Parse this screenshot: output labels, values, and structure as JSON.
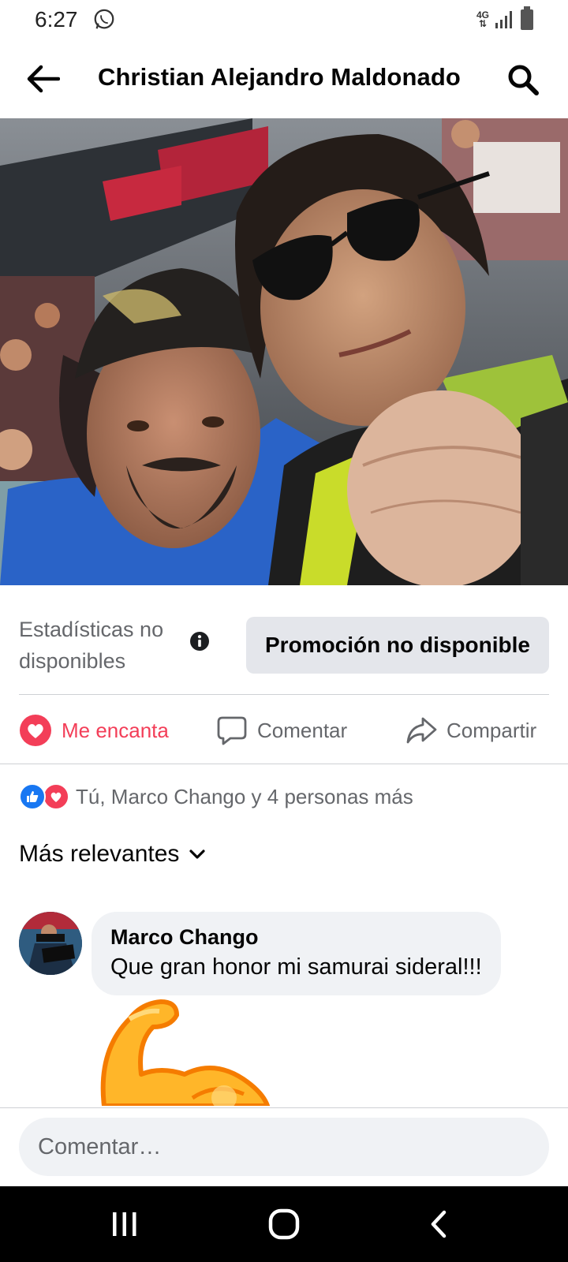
{
  "status_bar": {
    "time": "6:27",
    "network": "4G",
    "icons": [
      "whatsapp-icon",
      "signal-icon",
      "battery-icon"
    ]
  },
  "header": {
    "title": "Christian Alejandro Maldonado",
    "back_icon": "arrow-left-icon",
    "search_icon": "search-icon"
  },
  "post": {
    "photo_icon": "photo",
    "stats_text": "Estadísticas no disponibles",
    "promo_label": "Promoción no disponible"
  },
  "actions": {
    "love_label": "Me encanta",
    "comment_label": "Comentar",
    "share_label": "Compartir"
  },
  "reactions": {
    "summary": "Tú, Marco Chango y 4 personas más"
  },
  "comments": {
    "sort_label": "Más relevantes",
    "items": [
      {
        "author": "Marco Chango",
        "text": "Que gran honor mi samurai sideral!!!",
        "sticker_icon": "flexed-biceps-icon"
      }
    ]
  },
  "composer": {
    "placeholder": "Comentar…"
  },
  "colors": {
    "love": "#f33e58",
    "like": "#1877f2",
    "muted": "#65676b",
    "bubble": "#f0f2f5",
    "button": "#e4e6eb"
  }
}
